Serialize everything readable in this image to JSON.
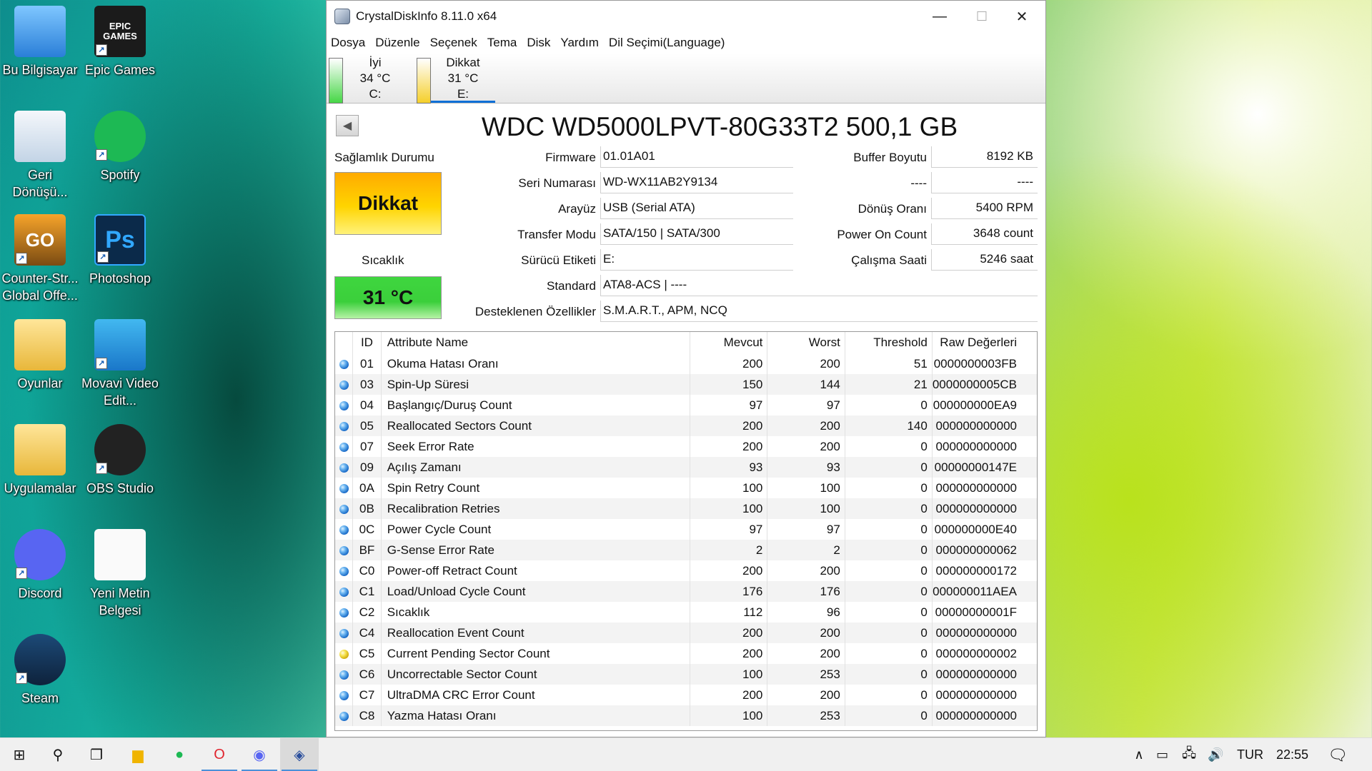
{
  "desktop": {
    "icons": [
      {
        "label": "Bu Bilgisayar",
        "icon": "computer-icon"
      },
      {
        "label": "Epic Games",
        "icon": "epic-games-icon"
      },
      {
        "label": "Geri Dönüşü...",
        "icon": "recycle-bin-icon"
      },
      {
        "label": "Spotify",
        "icon": "spotify-icon"
      },
      {
        "label": "Counter-Str... Global Offe...",
        "icon": "csgo-icon"
      },
      {
        "label": "Photoshop",
        "icon": "photoshop-icon"
      },
      {
        "label": "Oyunlar",
        "icon": "folder-icon"
      },
      {
        "label": "Movavi Video Edit...",
        "icon": "movavi-icon"
      },
      {
        "label": "Uygulamalar",
        "icon": "folder-icon"
      },
      {
        "label": "OBS Studio",
        "icon": "obs-icon"
      },
      {
        "label": "Discord",
        "icon": "discord-icon"
      },
      {
        "label": "Yeni Metin Belgesi",
        "icon": "text-file-icon"
      },
      {
        "label": "Steam",
        "icon": "steam-icon"
      }
    ],
    "icon_text": {
      "epic": "EPIC GAMES",
      "csgo": "GO",
      "ps": "Ps"
    }
  },
  "window": {
    "title": "CrystalDiskInfo 8.11.0 x64",
    "controls": {
      "minimize": "—",
      "maximize": "☐",
      "close": "✕"
    },
    "menu": [
      "Dosya",
      "Düzenle",
      "Seçenek",
      "Tema",
      "Disk",
      "Yardım",
      "Dil Seçimi(Language)"
    ],
    "drives": [
      {
        "status": "İyi",
        "temp": "34 °C",
        "letter": "C:",
        "color": "#46d646"
      },
      {
        "status": "Dikkat",
        "temp": "31 °C",
        "letter": "E:",
        "color": "#f5cf2a"
      }
    ],
    "disk_title": "WDC WD5000LPVT-80G33T2 500,1 GB",
    "health": {
      "label": "Sağlamlık Durumu",
      "status": "Dikkat",
      "status_color": "#ffd200",
      "temp_label": "Sıcaklık",
      "temp": "31 °C",
      "temp_color": "#3bd33b"
    },
    "info": {
      "firmware_label": "Firmware",
      "firmware": "01.01A01",
      "serial_label": "Seri Numarası",
      "serial": "WD-WX11AB2Y9134",
      "interface_label": "Arayüz",
      "interface": "USB (Serial ATA)",
      "transfer_label": "Transfer Modu",
      "transfer": "SATA/150 | SATA/300",
      "drive_label_label": "Sürücü Etiketi",
      "drive_label": "E:",
      "standard_label": "Standard",
      "standard": "ATA8-ACS | ----",
      "features_label": "Desteklenen Özellikler",
      "features": "S.M.A.R.T., APM, NCQ",
      "buffer_label": "Buffer Boyutu",
      "buffer": "8192 KB",
      "blank_label": "----",
      "blank": "----",
      "rotation_label": "Dönüş Oranı",
      "rotation": "5400 RPM",
      "poweron_count_label": "Power On Count",
      "poweron_count": "3648 count",
      "poweron_hours_label": "Çalışma Saati",
      "poweron_hours": "5246 saat"
    },
    "smart_table": {
      "headers": [
        "ID",
        "Attribute Name",
        "Mevcut",
        "Worst",
        "Threshold",
        "Raw Değerleri"
      ],
      "rows": [
        {
          "status": "good",
          "id": "01",
          "name": "Okuma Hatası Oranı",
          "current": "200",
          "worst": "200",
          "threshold": "51",
          "raw": "0000000003FB"
        },
        {
          "status": "good",
          "id": "03",
          "name": "Spin-Up Süresi",
          "current": "150",
          "worst": "144",
          "threshold": "21",
          "raw": "0000000005CB"
        },
        {
          "status": "good",
          "id": "04",
          "name": "Başlangıç/Duruş Count",
          "current": "97",
          "worst": "97",
          "threshold": "0",
          "raw": "000000000EA9"
        },
        {
          "status": "good",
          "id": "05",
          "name": "Reallocated Sectors Count",
          "current": "200",
          "worst": "200",
          "threshold": "140",
          "raw": "000000000000"
        },
        {
          "status": "good",
          "id": "07",
          "name": "Seek Error Rate",
          "current": "200",
          "worst": "200",
          "threshold": "0",
          "raw": "000000000000"
        },
        {
          "status": "good",
          "id": "09",
          "name": "Açılış Zamanı",
          "current": "93",
          "worst": "93",
          "threshold": "0",
          "raw": "00000000147E"
        },
        {
          "status": "good",
          "id": "0A",
          "name": "Spin Retry Count",
          "current": "100",
          "worst": "100",
          "threshold": "0",
          "raw": "000000000000"
        },
        {
          "status": "good",
          "id": "0B",
          "name": "Recalibration Retries",
          "current": "100",
          "worst": "100",
          "threshold": "0",
          "raw": "000000000000"
        },
        {
          "status": "good",
          "id": "0C",
          "name": "Power Cycle Count",
          "current": "97",
          "worst": "97",
          "threshold": "0",
          "raw": "000000000E40"
        },
        {
          "status": "good",
          "id": "BF",
          "name": "G-Sense Error Rate",
          "current": "2",
          "worst": "2",
          "threshold": "0",
          "raw": "000000000062"
        },
        {
          "status": "good",
          "id": "C0",
          "name": "Power-off Retract Count",
          "current": "200",
          "worst": "200",
          "threshold": "0",
          "raw": "000000000172"
        },
        {
          "status": "good",
          "id": "C1",
          "name": "Load/Unload Cycle Count",
          "current": "176",
          "worst": "176",
          "threshold": "0",
          "raw": "000000011AEA"
        },
        {
          "status": "good",
          "id": "C2",
          "name": "Sıcaklık",
          "current": "112",
          "worst": "96",
          "threshold": "0",
          "raw": "00000000001F"
        },
        {
          "status": "good",
          "id": "C4",
          "name": "Reallocation Event Count",
          "current": "200",
          "worst": "200",
          "threshold": "0",
          "raw": "000000000000"
        },
        {
          "status": "warn",
          "id": "C5",
          "name": "Current Pending Sector Count",
          "current": "200",
          "worst": "200",
          "threshold": "0",
          "raw": "000000000002"
        },
        {
          "status": "good",
          "id": "C6",
          "name": "Uncorrectable Sector Count",
          "current": "100",
          "worst": "253",
          "threshold": "0",
          "raw": "000000000000"
        },
        {
          "status": "good",
          "id": "C7",
          "name": "UltraDMA CRC Error Count",
          "current": "200",
          "worst": "200",
          "threshold": "0",
          "raw": "000000000000"
        },
        {
          "status": "good",
          "id": "C8",
          "name": "Yazma Hatası Oranı",
          "current": "100",
          "worst": "253",
          "threshold": "0",
          "raw": "000000000000"
        }
      ]
    }
  },
  "taskbar": {
    "items": [
      {
        "name": "start-icon",
        "glyph": "⊞"
      },
      {
        "name": "search-icon",
        "glyph": "⚲"
      },
      {
        "name": "task-view-icon",
        "glyph": "❐"
      },
      {
        "name": "file-explorer-icon",
        "glyph": "▆"
      },
      {
        "name": "spotify-icon",
        "glyph": "●"
      },
      {
        "name": "opera-icon",
        "glyph": "O"
      },
      {
        "name": "discord-icon",
        "glyph": "◉"
      },
      {
        "name": "crystaldiskinfo-icon",
        "glyph": "◈"
      }
    ],
    "tray": {
      "chevron": "∧",
      "language": "TUR",
      "time": "22:55"
    }
  }
}
